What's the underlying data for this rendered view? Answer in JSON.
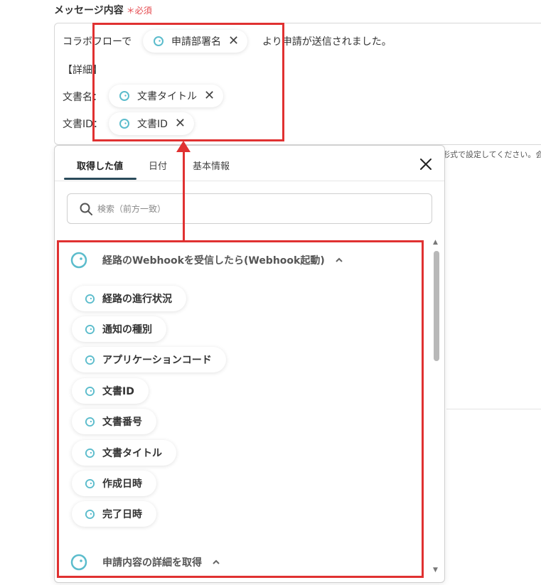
{
  "field": {
    "label": "メッセージ内容",
    "required_mark": "＊必須"
  },
  "message": {
    "line1_prefix": "コラボフローで",
    "line1_suffix": "より申請が送信されました。",
    "line2": "【詳細】",
    "line3_label": "文書名：",
    "line4_label": "文書ID：",
    "tokens": [
      {
        "label": "申請部署名"
      },
      {
        "label": "文書タイトル"
      },
      {
        "label": "文書ID"
      }
    ]
  },
  "hint_text": "形式で設定してください。会",
  "panel": {
    "tabs": [
      {
        "label": "取得した値",
        "active": true
      },
      {
        "label": "日付",
        "active": false
      },
      {
        "label": "基本情報",
        "active": false
      }
    ],
    "search": {
      "placeholder": "検索（前方一致）",
      "value": ""
    },
    "groups": [
      {
        "title": "経路のWebhookを受信したら(Webhook起動)",
        "expanded": true,
        "items": [
          {
            "label": "経路の進行状況"
          },
          {
            "label": "通知の種別"
          },
          {
            "label": "アプリケーションコード"
          },
          {
            "label": "文書ID"
          },
          {
            "label": "文書番号"
          },
          {
            "label": "文書タイトル"
          },
          {
            "label": "作成日時"
          },
          {
            "label": "完了日時"
          }
        ]
      },
      {
        "title": "申請内容の詳細を取得",
        "expanded": true,
        "items": []
      }
    ]
  },
  "colors": {
    "accent_teal": "#5bbccc",
    "highlight_red": "#e03131",
    "required_red": "#e5484d",
    "tab_underline": "#2a4a5a"
  }
}
